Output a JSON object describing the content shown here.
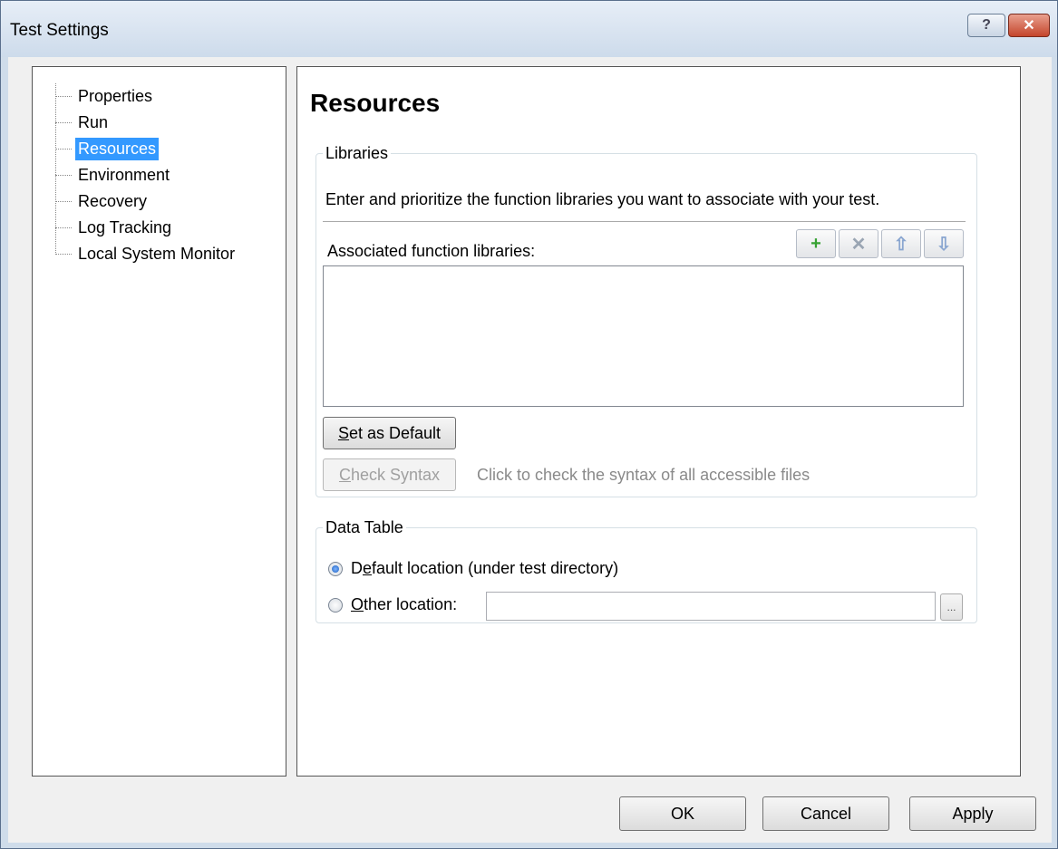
{
  "window": {
    "title": "Test Settings",
    "help_label": "?",
    "close_label": "✕"
  },
  "nav": {
    "items": [
      {
        "label": "Properties",
        "selected": false
      },
      {
        "label": "Run",
        "selected": false
      },
      {
        "label": "Resources",
        "selected": true
      },
      {
        "label": "Environment",
        "selected": false
      },
      {
        "label": "Recovery",
        "selected": false
      },
      {
        "label": "Log Tracking",
        "selected": false
      },
      {
        "label": "Local System Monitor",
        "selected": false
      }
    ]
  },
  "page": {
    "title": "Resources"
  },
  "libraries": {
    "legend": "Libraries",
    "description": "Enter and prioritize the function libraries you want to associate with your test.",
    "associated_label": "Associated function libraries:",
    "tools": {
      "add": "+",
      "remove": "✕",
      "up": "⇧",
      "down": "⇩"
    },
    "items": [],
    "set_default": {
      "accel": "S",
      "rest": "et as Default"
    },
    "check_syntax": {
      "accel": "C",
      "rest": "heck Syntax"
    },
    "check_hint": "Click to check the syntax of all accessible files"
  },
  "data_table": {
    "legend": "Data Table",
    "default_option": {
      "before": "D",
      "accel": "e",
      "rest": "fault location (under test directory)",
      "checked": true
    },
    "other_option": {
      "accel": "O",
      "rest": "ther location:",
      "checked": false
    },
    "other_value": "",
    "browse_label": "..."
  },
  "footer": {
    "ok": "OK",
    "cancel": "Cancel",
    "apply": "Apply"
  }
}
